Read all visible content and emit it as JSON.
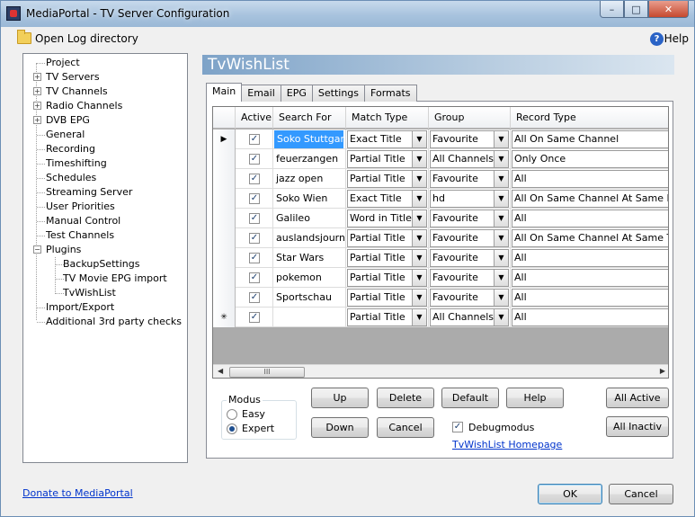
{
  "window": {
    "title": "MediaPortal - TV Server Configuration"
  },
  "toolbar": {
    "open_log_label": "Open Log directory",
    "help_label": "Help"
  },
  "tree": {
    "items": [
      {
        "label": "Project"
      },
      {
        "label": "TV Servers"
      },
      {
        "label": "TV Channels"
      },
      {
        "label": "Radio Channels"
      },
      {
        "label": "DVB EPG"
      },
      {
        "label": "General"
      },
      {
        "label": "Recording"
      },
      {
        "label": "Timeshifting"
      },
      {
        "label": "Schedules"
      },
      {
        "label": "Streaming Server"
      },
      {
        "label": "User Priorities"
      },
      {
        "label": "Manual Control"
      },
      {
        "label": "Test Channels"
      },
      {
        "label": "Plugins"
      },
      {
        "label": "BackupSettings"
      },
      {
        "label": "TV Movie EPG import"
      },
      {
        "label": "TvWishList"
      },
      {
        "label": "Import/Export"
      },
      {
        "label": "Additional 3rd party checks"
      }
    ]
  },
  "panel": {
    "title": "TvWishList"
  },
  "tabs": [
    {
      "label": "Main"
    },
    {
      "label": "Email"
    },
    {
      "label": "EPG"
    },
    {
      "label": "Settings"
    },
    {
      "label": "Formats"
    }
  ],
  "grid": {
    "headers": [
      "Active",
      "Search For",
      "Match Type",
      "Group",
      "Record Type"
    ],
    "rows": [
      {
        "search": "Soko Stuttgart",
        "match": "Exact Title",
        "group": "Favourite",
        "record": "All On Same Channel"
      },
      {
        "search": "feuerzangen",
        "match": "Partial Title",
        "group": "All Channels",
        "record": "Only Once"
      },
      {
        "search": "jazz open",
        "match": "Partial Title",
        "group": "Favourite",
        "record": "All"
      },
      {
        "search": "Soko Wien",
        "match": "Exact Title",
        "group": "hd",
        "record": "All On Same Channel At Same Day"
      },
      {
        "search": "Galileo",
        "match": "Word in Title",
        "group": "Favourite",
        "record": "All"
      },
      {
        "search": "auslandsjournal",
        "match": "Partial Title",
        "group": "Favourite",
        "record": "All On Same Channel At Same Time"
      },
      {
        "search": "Star Wars",
        "match": "Partial Title",
        "group": "Favourite",
        "record": "All"
      },
      {
        "search": "pokemon",
        "match": "Partial Title",
        "group": "Favourite",
        "record": "All"
      },
      {
        "search": "Sportschau",
        "match": "Partial Title",
        "group": "Favourite",
        "record": "All"
      },
      {
        "search": "",
        "match": "Partial Title",
        "group": "All Channels",
        "record": "All"
      }
    ],
    "scroll_thumb": "III"
  },
  "modus": {
    "label": "Modus",
    "easy": "Easy",
    "expert": "Expert",
    "selected": "Expert"
  },
  "buttons": {
    "up": "Up",
    "delete": "Delete",
    "default": "Default",
    "help": "Help",
    "all_active": "All Active",
    "down": "Down",
    "cancel": "Cancel",
    "all_inactive": "All Inactiv"
  },
  "debug": {
    "label": "Debugmodus",
    "checked": true
  },
  "homepage_link": "TvWishList Homepage",
  "footer": {
    "donate_link": "Donate to MediaPortal",
    "ok": "OK",
    "cancel": "Cancel"
  },
  "glyphs": {
    "check": "✓",
    "expand": "+",
    "collapse": "−",
    "arrow_down": "▼",
    "current_row": "▶",
    "new_row": "✳",
    "arrow_left": "◀",
    "arrow_right": "▶",
    "help_q": "?"
  },
  "colors": {
    "selection": "#3399ff",
    "link": "#0033cc",
    "panel_title_bg": "#7ea3c8"
  }
}
